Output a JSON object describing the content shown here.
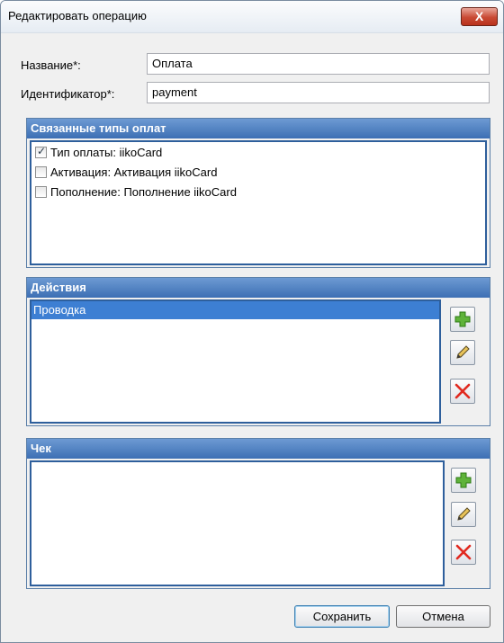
{
  "window": {
    "title": "Редактировать операцию",
    "close_label": "X"
  },
  "form": {
    "name_label": "Название*:",
    "name_value": "Оплата",
    "id_label": "Идентификатор*:",
    "id_value": "payment"
  },
  "payment_types": {
    "header": "Связанные типы оплат",
    "items": [
      {
        "label": "Тип оплаты: iikoCard",
        "checked": true
      },
      {
        "label": "Активация: Активация iikoCard",
        "checked": false
      },
      {
        "label": "Пополнение: Пополнение iikoCard",
        "checked": false
      }
    ]
  },
  "actions": {
    "header": "Действия",
    "items": [
      "Проводка"
    ]
  },
  "receipt": {
    "header": "Чек",
    "items": []
  },
  "buttons": {
    "save": "Сохранить",
    "cancel": "Отмена"
  },
  "icons": {
    "add": "plus-icon",
    "edit": "pencil-icon",
    "delete": "red-x-icon"
  }
}
